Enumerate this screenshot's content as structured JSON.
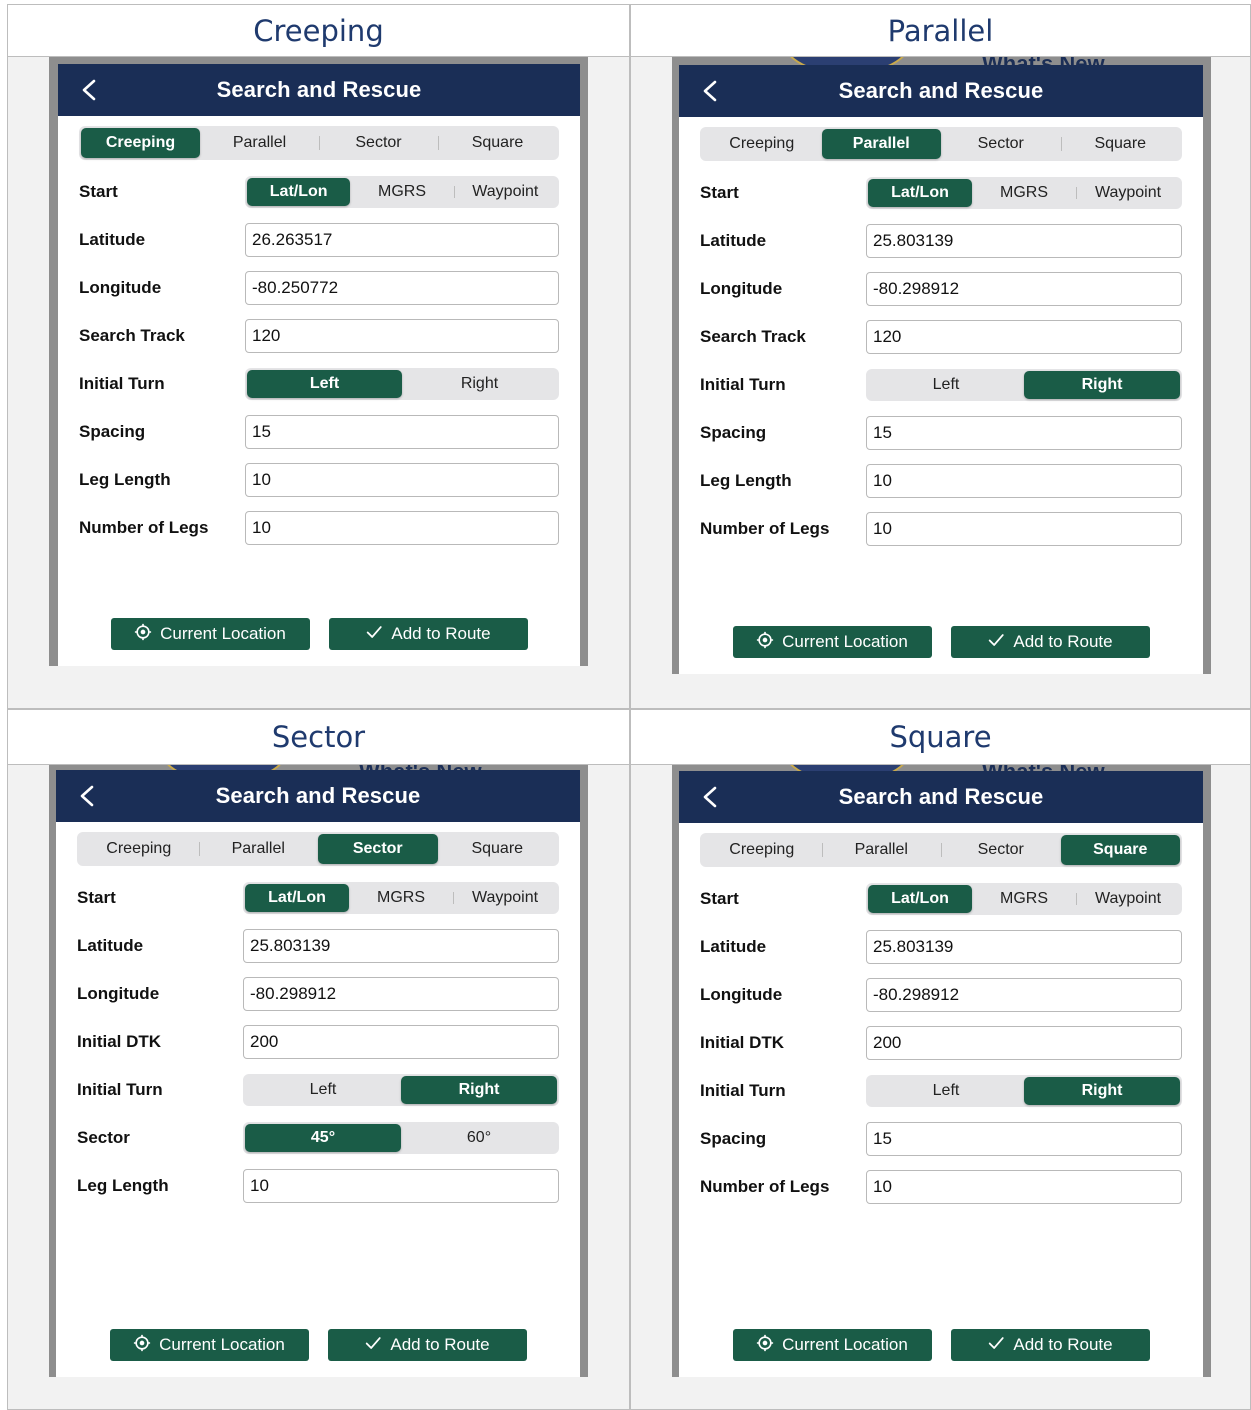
{
  "colors": {
    "nav": "#1a2e56",
    "accent": "#1a5c47",
    "heading": "#1f3a6e"
  },
  "panels": [
    {
      "heading": "Creeping",
      "background": {
        "label": "",
        "show_seal": false
      },
      "dialog": {
        "title": "Search and Rescue",
        "back_icon": "chevron-left-icon",
        "tabs": [
          "Creeping",
          "Parallel",
          "Sector",
          "Square"
        ],
        "active_tab": 0,
        "rows": [
          {
            "label": "Start",
            "type": "segment",
            "options": [
              "Lat/Lon",
              "MGRS",
              "Waypoint"
            ],
            "active": 0
          },
          {
            "label": "Latitude",
            "type": "field",
            "value": "26.263517"
          },
          {
            "label": "Longitude",
            "type": "field",
            "value": "-80.250772"
          },
          {
            "label": "Search Track",
            "type": "field",
            "value": "120"
          },
          {
            "label": "Initial Turn",
            "type": "segment",
            "options": [
              "Left",
              "Right"
            ],
            "active": 0
          },
          {
            "label": "Spacing",
            "type": "field",
            "value": "15"
          },
          {
            "label": "Leg Length",
            "type": "field",
            "value": "10"
          },
          {
            "label": "Number of Legs",
            "type": "field",
            "value": "10"
          }
        ],
        "current_location_label": "Current Location",
        "add_to_route_label": "Add to Route",
        "location_icon": "location-target-icon",
        "check_icon": "checkmark-icon"
      }
    },
    {
      "heading": "Parallel",
      "background": {
        "label": "What's New",
        "show_seal": true
      },
      "dialog": {
        "title": "Search and Rescue",
        "back_icon": "chevron-left-icon",
        "tabs": [
          "Creeping",
          "Parallel",
          "Sector",
          "Square"
        ],
        "active_tab": 1,
        "rows": [
          {
            "label": "Start",
            "type": "segment",
            "options": [
              "Lat/Lon",
              "MGRS",
              "Waypoint"
            ],
            "active": 0
          },
          {
            "label": "Latitude",
            "type": "field",
            "value": "25.803139"
          },
          {
            "label": "Longitude",
            "type": "field",
            "value": "-80.298912"
          },
          {
            "label": "Search Track",
            "type": "field",
            "value": "120"
          },
          {
            "label": "Initial Turn",
            "type": "segment",
            "options": [
              "Left",
              "Right"
            ],
            "active": 1
          },
          {
            "label": "Spacing",
            "type": "field",
            "value": "15"
          },
          {
            "label": "Leg Length",
            "type": "field",
            "value": "10"
          },
          {
            "label": "Number of Legs",
            "type": "field",
            "value": "10"
          }
        ],
        "current_location_label": "Current Location",
        "add_to_route_label": "Add to Route",
        "location_icon": "location-target-icon",
        "check_icon": "checkmark-icon"
      }
    },
    {
      "heading": "Sector",
      "background": {
        "label": "What's New",
        "show_seal": true
      },
      "dialog": {
        "title": "Search and Rescue",
        "back_icon": "chevron-left-icon",
        "tabs": [
          "Creeping",
          "Parallel",
          "Sector",
          "Square"
        ],
        "active_tab": 2,
        "rows": [
          {
            "label": "Start",
            "type": "segment",
            "options": [
              "Lat/Lon",
              "MGRS",
              "Waypoint"
            ],
            "active": 0
          },
          {
            "label": "Latitude",
            "type": "field",
            "value": "25.803139"
          },
          {
            "label": "Longitude",
            "type": "field",
            "value": "-80.298912"
          },
          {
            "label": "Initial DTK",
            "type": "field",
            "value": "200"
          },
          {
            "label": "Initial Turn",
            "type": "segment",
            "options": [
              "Left",
              "Right"
            ],
            "active": 1
          },
          {
            "label": "Sector",
            "type": "segment",
            "options": [
              "45°",
              "60°"
            ],
            "active": 0
          },
          {
            "label": "Leg Length",
            "type": "field",
            "value": "10"
          }
        ],
        "current_location_label": "Current Location",
        "add_to_route_label": "Add to Route",
        "location_icon": "location-target-icon",
        "check_icon": "checkmark-icon"
      }
    },
    {
      "heading": "Square",
      "background": {
        "label": "What's New",
        "show_seal": true
      },
      "dialog": {
        "title": "Search and Rescue",
        "back_icon": "chevron-left-icon",
        "tabs": [
          "Creeping",
          "Parallel",
          "Sector",
          "Square"
        ],
        "active_tab": 3,
        "rows": [
          {
            "label": "Start",
            "type": "segment",
            "options": [
              "Lat/Lon",
              "MGRS",
              "Waypoint"
            ],
            "active": 0
          },
          {
            "label": "Latitude",
            "type": "field",
            "value": "25.803139"
          },
          {
            "label": "Longitude",
            "type": "field",
            "value": "-80.298912"
          },
          {
            "label": "Initial DTK",
            "type": "field",
            "value": "200"
          },
          {
            "label": "Initial Turn",
            "type": "segment",
            "options": [
              "Left",
              "Right"
            ],
            "active": 1
          },
          {
            "label": "Spacing",
            "type": "field",
            "value": "15"
          },
          {
            "label": "Number of Legs",
            "type": "field",
            "value": "10"
          }
        ],
        "current_location_label": "Current Location",
        "add_to_route_label": "Add to Route",
        "location_icon": "location-target-icon",
        "check_icon": "checkmark-icon"
      }
    }
  ]
}
